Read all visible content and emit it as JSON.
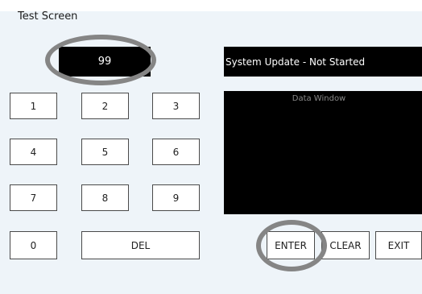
{
  "window": {
    "title": "Test Screen"
  },
  "display": {
    "value": "99"
  },
  "status": {
    "text": "System Update - Not Started"
  },
  "data_window": {
    "label": "Data Window"
  },
  "keypad": {
    "k1": "1",
    "k2": "2",
    "k3": "3",
    "k4": "4",
    "k5": "5",
    "k6": "6",
    "k7": "7",
    "k8": "8",
    "k9": "9",
    "k0": "0",
    "del": "DEL"
  },
  "actions": {
    "enter": "ENTER",
    "clear": "CLEAR",
    "exit": "EXIT"
  },
  "colors": {
    "background": "#eef4f9",
    "panel": "#000000",
    "highlight_ring": "#858585"
  }
}
